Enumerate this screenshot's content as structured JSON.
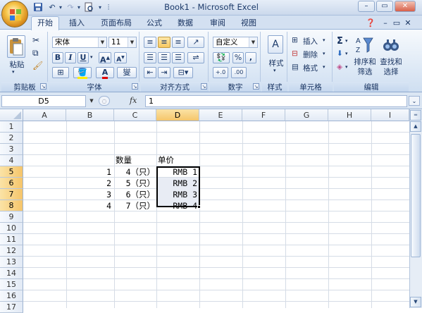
{
  "window": {
    "title": "Book1 - Microsoft Excel"
  },
  "quick_access": {
    "save_icon": "save-icon",
    "undo_icon": "undo-icon",
    "redo_icon": "redo-icon",
    "preview_icon": "print-preview-icon",
    "customize_icon": "customize-qat-icon"
  },
  "window_controls": {
    "minimize": "–",
    "restore": "▭",
    "close": "✕"
  },
  "tabs": [
    "开始",
    "插入",
    "页面布局",
    "公式",
    "数据",
    "审阅",
    "视图"
  ],
  "active_tab": "开始",
  "ribbon": {
    "clipboard": {
      "label": "剪贴板",
      "paste_label": "粘贴"
    },
    "font": {
      "label": "字体",
      "font_name": "宋体",
      "font_size": "11",
      "bold": "B",
      "italic": "I",
      "underline": "U",
      "grow": "A",
      "shrink": "A",
      "phonetic": "燮"
    },
    "alignment": {
      "label": "对齐方式"
    },
    "number": {
      "label": "数字",
      "format": "自定义",
      "percent": "%",
      "comma": ","
    },
    "styles": {
      "label": "样式"
    },
    "cells": {
      "label": "单元格",
      "insert": "插入",
      "delete": "删除",
      "format": "格式"
    },
    "editing": {
      "label": "编辑",
      "sort_filter": "排序和\n筛选",
      "sort_filter_line1": "排序和",
      "sort_filter_line2": "筛选",
      "find_line1": "查找和",
      "find_line2": "选择",
      "sum": "Σ"
    }
  },
  "formula_bar": {
    "name_box": "D5",
    "fx": "fx",
    "value": "1"
  },
  "sheet": {
    "columns": [
      "A",
      "B",
      "C",
      "D",
      "E",
      "F",
      "G",
      "H",
      "I"
    ],
    "rows": [
      "1",
      "2",
      "3",
      "4",
      "5",
      "6",
      "7",
      "8",
      "9",
      "10",
      "11",
      "12",
      "13",
      "14",
      "15",
      "16",
      "17"
    ],
    "selected_column": "D",
    "selected_rows": [
      "5",
      "6",
      "7",
      "8"
    ],
    "headers": {
      "C4": "数量",
      "D4": "单价"
    },
    "data": [
      {
        "row": "5",
        "B": "1",
        "C": "4（只）",
        "D": "RMB 1"
      },
      {
        "row": "6",
        "B": "2",
        "C": "5（只）",
        "D": "RMB 2"
      },
      {
        "row": "7",
        "B": "3",
        "C": "6（只）",
        "D": "RMB 3"
      },
      {
        "row": "8",
        "B": "4",
        "C": "7（只）",
        "D": "RMB 4"
      }
    ]
  },
  "colors": {
    "selection_header": "#f5c56a",
    "ribbon": "#dbe7f5",
    "accent": "#15305e"
  }
}
